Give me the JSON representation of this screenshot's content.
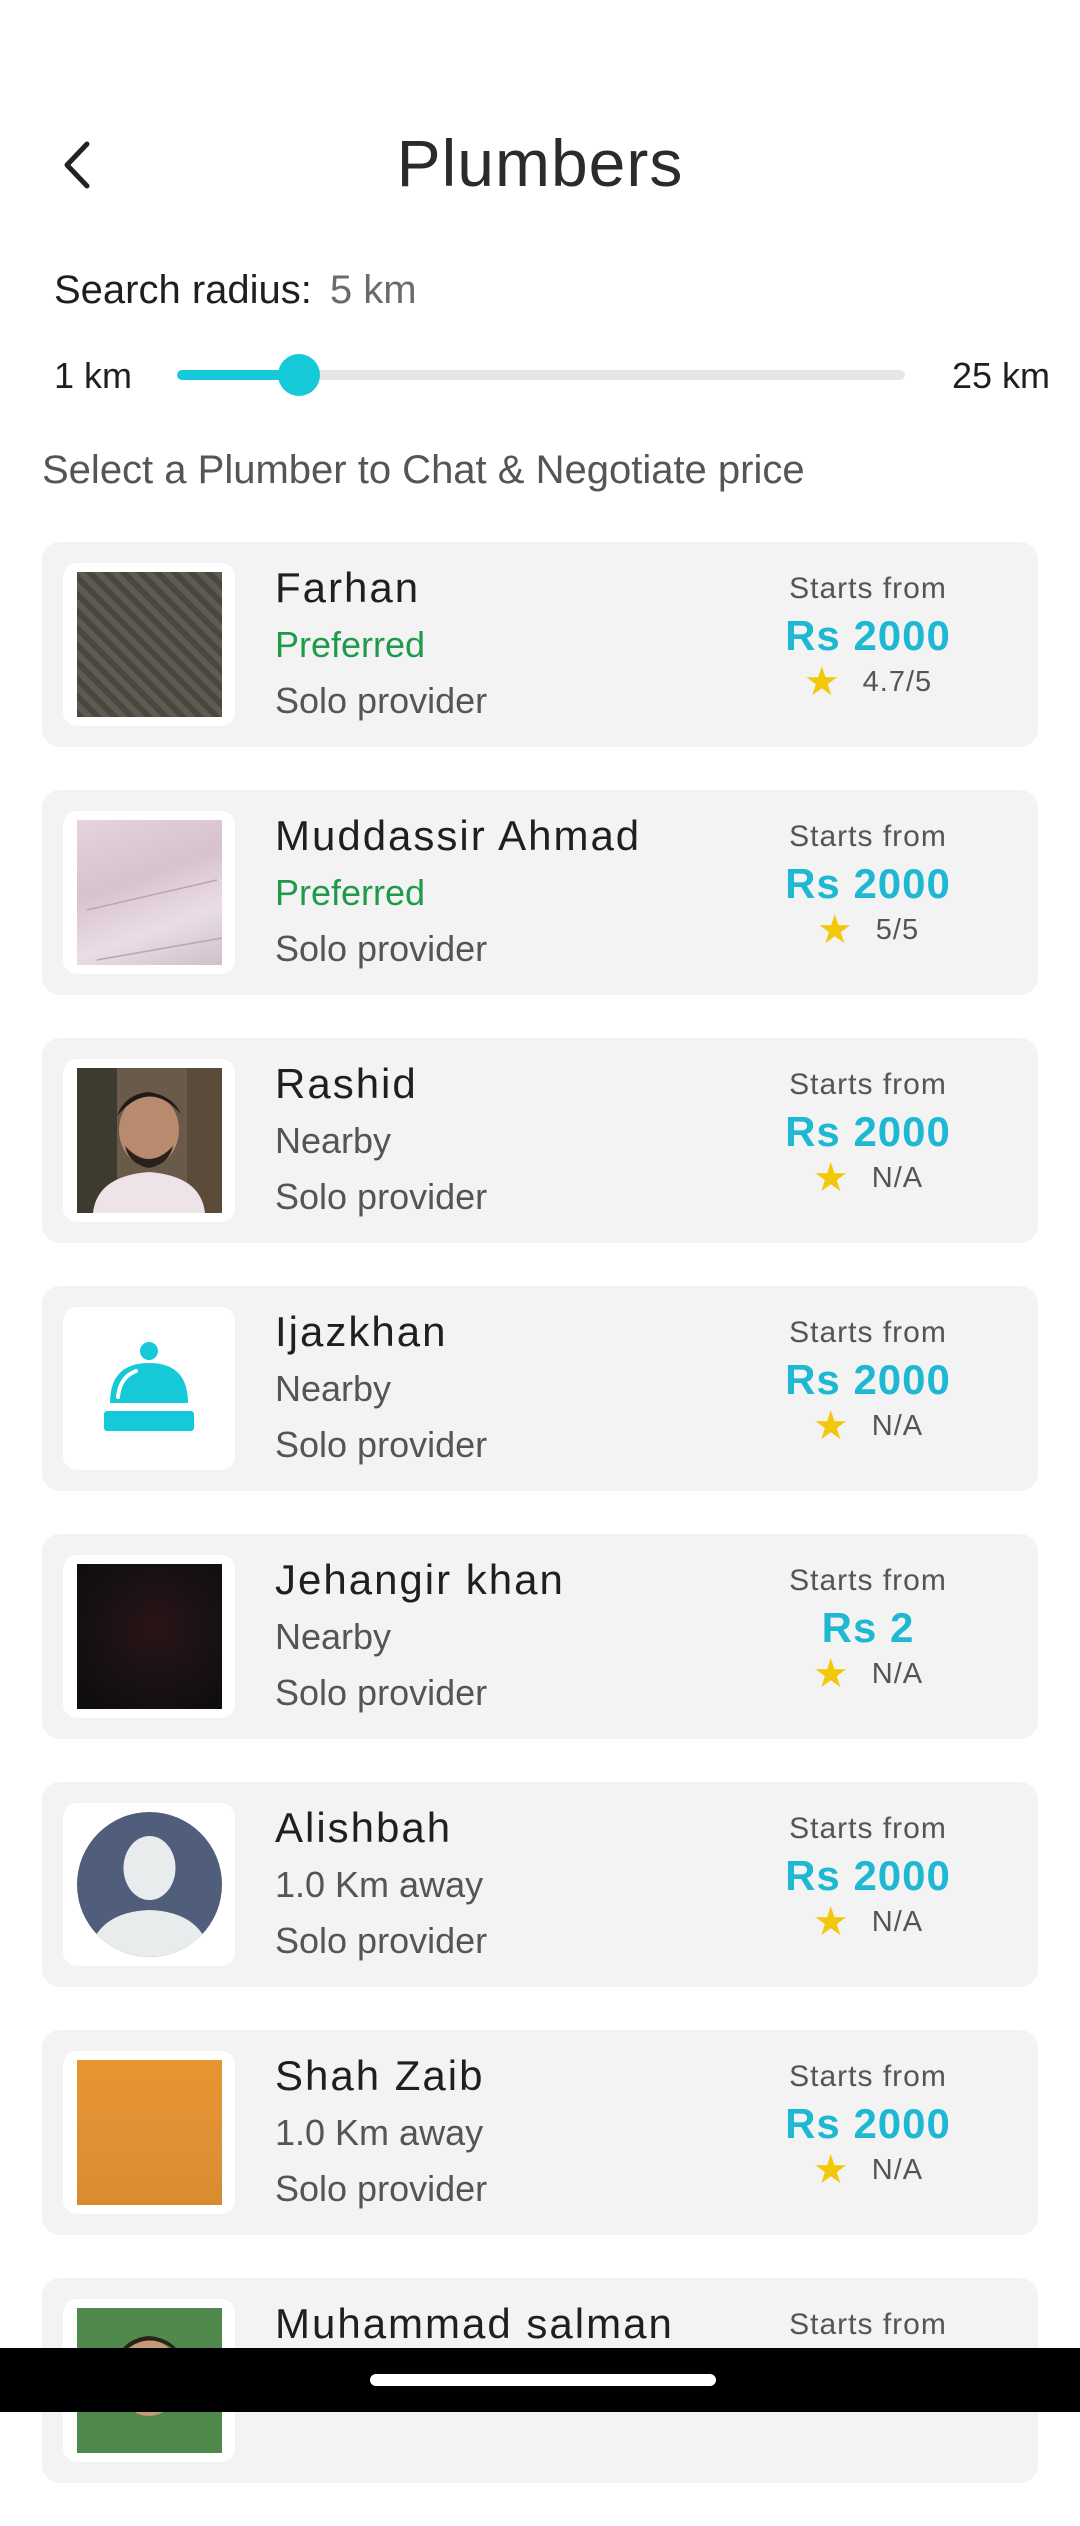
{
  "header": {
    "title": "Plumbers"
  },
  "radius": {
    "label": "Search radius:",
    "value": "5 km"
  },
  "slider": {
    "min_label": "1 km",
    "max_label": "25 km",
    "value_fraction": 0.167,
    "accent": "#16c9d9"
  },
  "instruction": "Select a Plumber to Chat & Negotiate price",
  "providers": [
    {
      "name": "Farhan",
      "tag": "Preferred",
      "provider": "Solo provider",
      "starts": "Starts from",
      "price": "Rs 2000",
      "rating": "4.7/5"
    },
    {
      "name": "Muddassir Ahmad",
      "tag": "Preferred",
      "provider": "Solo provider",
      "starts": "Starts from",
      "price": "Rs 2000",
      "rating": "5/5"
    },
    {
      "name": "Rashid",
      "tag": "Nearby",
      "provider": "Solo provider",
      "starts": "Starts from",
      "price": "Rs 2000",
      "rating": "N/A"
    },
    {
      "name": "Ijazkhan",
      "tag": "Nearby",
      "provider": "Solo provider",
      "starts": "Starts from",
      "price": "Rs 2000",
      "rating": "N/A"
    },
    {
      "name": "Jehangir khan",
      "tag": "Nearby",
      "provider": "Solo provider",
      "starts": "Starts from",
      "price": "Rs 2",
      "rating": "N/A"
    },
    {
      "name": "Alishbah",
      "tag": "1.0 Km away",
      "provider": "Solo provider",
      "starts": "Starts from",
      "price": "Rs 2000",
      "rating": "N/A"
    },
    {
      "name": "Shah Zaib",
      "tag": "1.0 Km away",
      "provider": "Solo provider",
      "starts": "Starts from",
      "price": "Rs 2000",
      "rating": "N/A"
    },
    {
      "name": "Muhammad salman",
      "tag": "",
      "provider": "",
      "starts": "Starts from",
      "price": "",
      "rating": ""
    }
  ],
  "colors": {
    "preferred": "#1f9a4a",
    "price": "#1fb8d2",
    "star": "#f3c80b"
  }
}
